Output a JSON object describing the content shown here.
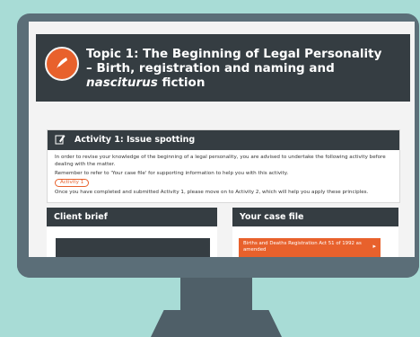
{
  "topic": {
    "icon": "quill-pen-icon",
    "title_main": "Topic 1: The Beginning of Legal Personality – Birth, registration and naming and ",
    "title_italic": "nasciturus",
    "title_tail": " fiction"
  },
  "activity": {
    "icon": "pencil-edit-icon",
    "heading": "Activity 1: Issue spotting",
    "paragraph1": "In order to revise your knowledge of the beginning of a legal personality, you are advised to undertake the following activity before dealing with the matter.",
    "paragraph2": "Remember to refer to 'Your case file' for supporting information to help you with this activity.",
    "pill_label": "Activity 1",
    "paragraph3": "Once you have completed and submitted Activity 1, please move on to Activity 2, which will help you apply these principles."
  },
  "client_brief": {
    "heading": "Client brief"
  },
  "case_file": {
    "heading": "Your case file",
    "item_label": "Births and Deaths Registration Act 51 of 1992 as amended",
    "item_icon": "arrow-right-icon"
  },
  "colors": {
    "accent": "#e8612c",
    "dark": "#353d42",
    "frame": "#5b6e78",
    "background": "#a8dcd6"
  }
}
